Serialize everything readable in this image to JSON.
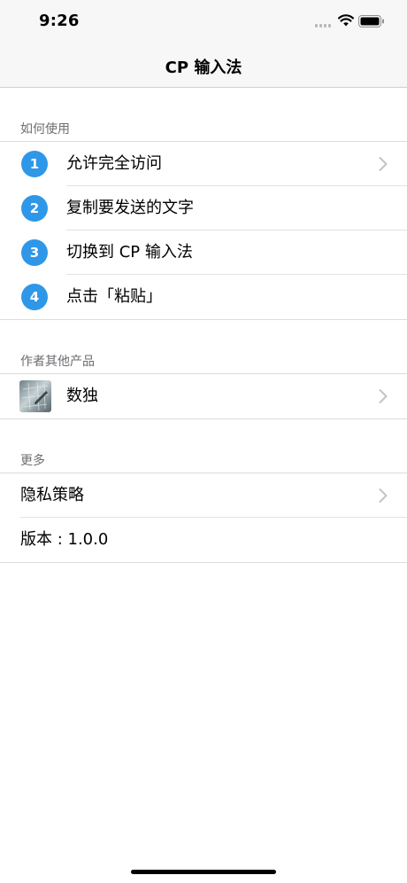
{
  "status_bar": {
    "time": "9:26"
  },
  "nav": {
    "title": "CP 输入法"
  },
  "how_to": {
    "header": "如何使用",
    "steps": [
      {
        "number": "1",
        "label": "允许完全访问",
        "has_chevron": true
      },
      {
        "number": "2",
        "label": "复制要发送的文字",
        "has_chevron": false
      },
      {
        "number": "3",
        "label": "切换到 CP 输入法",
        "has_chevron": false
      },
      {
        "number": "4",
        "label": "点击「粘贴」",
        "has_chevron": false
      }
    ]
  },
  "other_products": {
    "header": "作者其他产品",
    "items": [
      {
        "label": "数独",
        "icon": "sudoku-app-icon"
      }
    ]
  },
  "more": {
    "header": "更多",
    "items": [
      {
        "label": "隐私策略"
      },
      {
        "label": "版本 : 1.0.0"
      }
    ]
  },
  "colors": {
    "accent": "#2f97e8",
    "nav_background": "#f7f7f7",
    "section_header": "#6d6d72",
    "chevron": "#c4c4c7"
  }
}
